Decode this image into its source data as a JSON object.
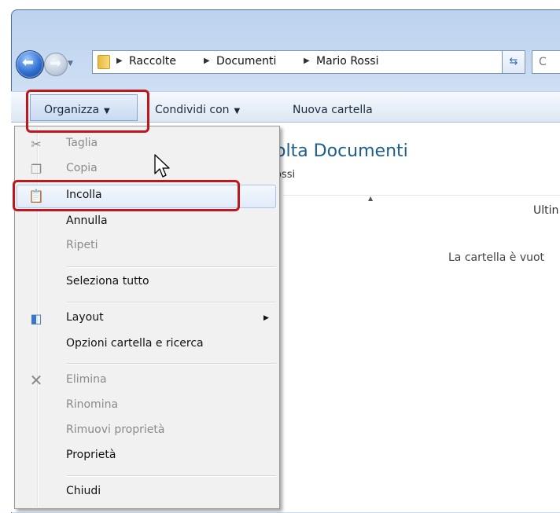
{
  "address": {
    "breadcrumbs": [
      "Raccolte",
      "Documenti",
      "Mario Rossi"
    ],
    "search_placeholder": "C"
  },
  "toolbar": {
    "organize_label": "Organizza",
    "share_label": "Condividi con",
    "new_folder_label": "Nuova cartella"
  },
  "content": {
    "library_title": "olta Documenti",
    "library_subtitle": "ossi",
    "column_header": "Ultin",
    "empty_message": "La cartella è vuot"
  },
  "menu": {
    "cut_label": "Taglia",
    "copy_label": "Copia",
    "paste_label": "Incolla",
    "undo_label": "Annulla",
    "redo_label": "Ripeti",
    "select_all_label": "Seleziona tutto",
    "layout_label": "Layout",
    "options_label": "Opzioni cartella e ricerca",
    "delete_label": "Elimina",
    "rename_label": "Rinomina",
    "remove_properties_label": "Rimuovi proprietà",
    "properties_label": "Proprietà",
    "close_label": "Chiudi"
  },
  "icons": {
    "back": "back-arrow-icon",
    "forward": "forward-arrow-icon",
    "folder": "folder-icon",
    "refresh": "refresh-icon",
    "cut": "scissors-icon",
    "copy": "copy-icon",
    "paste": "clipboard-icon",
    "layout": "layout-pane-icon",
    "delete": "delete-x-icon"
  },
  "colors": {
    "accent": "#1e5e8c",
    "callout": "#c0171d",
    "highlight_border": "#a9c4e7"
  }
}
